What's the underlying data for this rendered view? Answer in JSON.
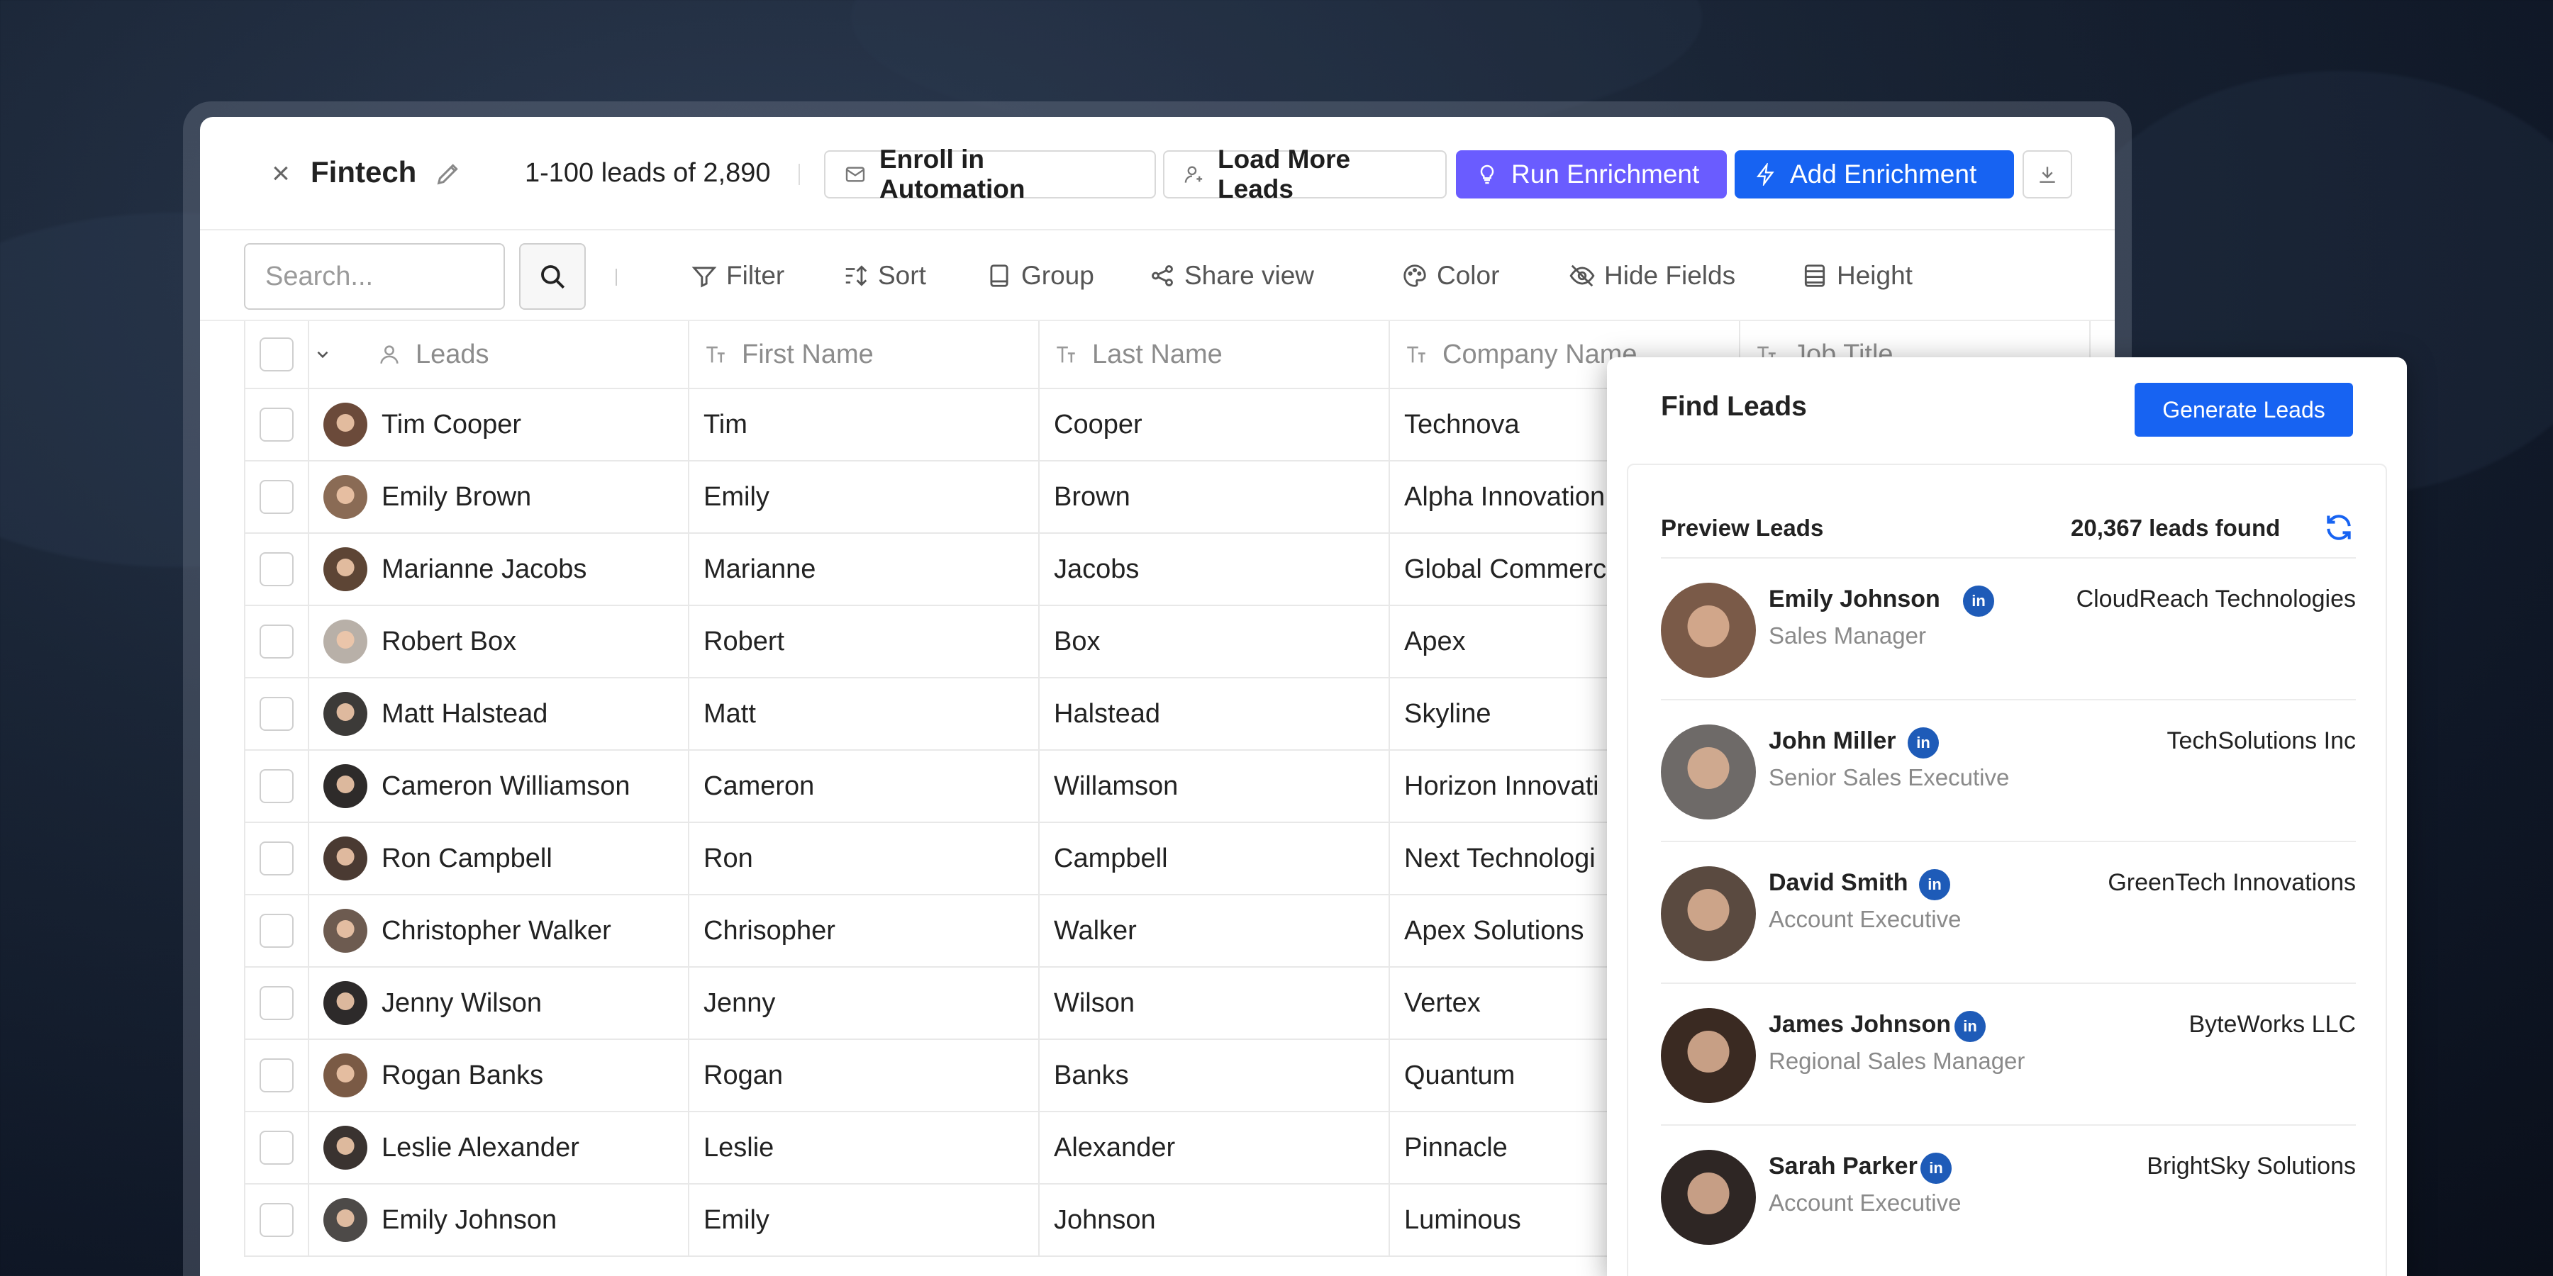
{
  "header": {
    "title": "Fintech",
    "lead_count": "1-100 leads of 2,890",
    "enroll_label": "Enroll in Automation",
    "load_label": "Load More Leads",
    "run_label": "Run Enrichment",
    "add_label": "Add Enrichment"
  },
  "toolbar": {
    "search_placeholder": "Search...",
    "filter": "Filter",
    "sort": "Sort",
    "group": "Group",
    "share": "Share view",
    "color": "Color",
    "hide": "Hide Fields",
    "height": "Height"
  },
  "table": {
    "headers": {
      "leads": "Leads",
      "first": "First Name",
      "last": "Last Name",
      "company": "Company Name",
      "job": "Job Title"
    },
    "rows": [
      {
        "lead": "Tim Cooper",
        "first": "Tim",
        "last": "Cooper",
        "company": "Technova"
      },
      {
        "lead": "Emily Brown",
        "first": "Emily",
        "last": "Brown",
        "company": "Alpha Innovation"
      },
      {
        "lead": "Marianne Jacobs",
        "first": "Marianne",
        "last": "Jacobs",
        "company": "Global Commerce"
      },
      {
        "lead": "Robert Box",
        "first": "Robert",
        "last": "Box",
        "company": "Apex"
      },
      {
        "lead": "Matt Halstead",
        "first": "Matt",
        "last": "Halstead",
        "company": "Skyline"
      },
      {
        "lead": "Cameron Williamson",
        "first": "Cameron",
        "last": "Willamson",
        "company": "Horizon Innovati"
      },
      {
        "lead": "Ron Campbell",
        "first": "Ron",
        "last": "Campbell",
        "company": "Next Technologi"
      },
      {
        "lead": "Christopher Walker",
        "first": "Chrisopher",
        "last": "Walker",
        "company": "Apex Solutions"
      },
      {
        "lead": "Jenny Wilson",
        "first": "Jenny",
        "last": "Wilson",
        "company": "Vertex"
      },
      {
        "lead": "Rogan Banks",
        "first": "Rogan",
        "last": "Banks",
        "company": "Quantum"
      },
      {
        "lead": "Leslie Alexander",
        "first": "Leslie",
        "last": "Alexander",
        "company": "Pinnacle"
      },
      {
        "lead": "Emily Johnson",
        "first": "Emily",
        "last": "Johnson",
        "company": "Luminous"
      }
    ]
  },
  "panel": {
    "title": "Find Leads",
    "generate_label": "Generate Leads",
    "preview_label": "Preview Leads",
    "found_label": "20,367 leads found",
    "leads": [
      {
        "name": "Emily Johnson",
        "title": "Sales Manager",
        "company": "CloudReach Technologies"
      },
      {
        "name": "John Miller",
        "title": "Senior Sales Executive",
        "company": "TechSolutions Inc"
      },
      {
        "name": "David Smith",
        "title": "Account Executive",
        "company": "GreenTech Innovations"
      },
      {
        "name": "James Johnson",
        "title": "Regional Sales Manager",
        "company": "ByteWorks LLC"
      },
      {
        "name": "Sarah Parker",
        "title": "Account Executive",
        "company": "BrightSky Solutions"
      }
    ]
  },
  "colors": {
    "run_enrichment": "#6a5cff",
    "add_enrichment": "#1763f2",
    "generate_leads": "#1763f2",
    "linkedin": "#1e5bb8"
  }
}
